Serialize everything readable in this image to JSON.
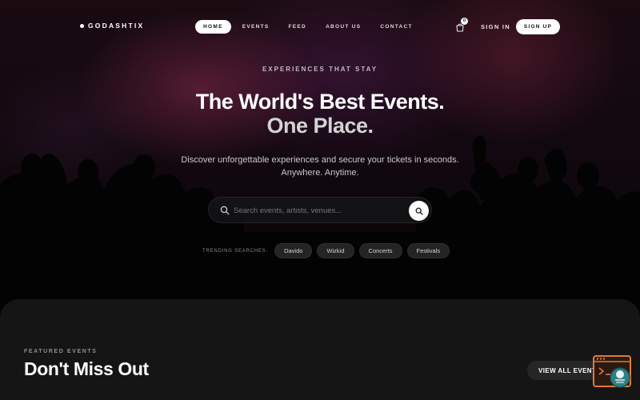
{
  "brand": {
    "name": "GODASHTIX"
  },
  "nav": {
    "items": [
      {
        "label": "HOME",
        "active": true
      },
      {
        "label": "EVENTS",
        "active": false
      },
      {
        "label": "FEED",
        "active": false
      },
      {
        "label": "ABOUT US",
        "active": false
      },
      {
        "label": "CONTACT",
        "active": false
      }
    ],
    "cart_count": "0",
    "signin_label": "SIGN IN",
    "signup_label": "SIGN UP"
  },
  "hero": {
    "eyebrow": "EXPERIENCES THAT STAY",
    "headline_line1": "The World's Best Events.",
    "headline_line2": "One Place.",
    "subtitle_line1": "Discover unforgettable experiences and secure your tickets in seconds.",
    "subtitle_line2": "Anywhere. Anytime."
  },
  "search": {
    "placeholder": "Search events, artists, venues...",
    "value": ""
  },
  "trending": {
    "label": "TRENDING SEARCHES:",
    "chips": [
      "Davido",
      "Wizkid",
      "Concerts",
      "Festivals"
    ]
  },
  "featured": {
    "eyebrow": "FEATURED EVENTS",
    "title": "Don't Miss Out",
    "view_all_label": "VIEW ALL EVENTS"
  },
  "icons": {
    "cart": "shopping-bag-icon",
    "search": "search-icon",
    "chat": "chat-widget-icon"
  },
  "colors": {
    "background": "#0d0d0d",
    "section": "#151515",
    "accent_widget": "#e07a3a",
    "widget_teal": "#2f7f86"
  }
}
